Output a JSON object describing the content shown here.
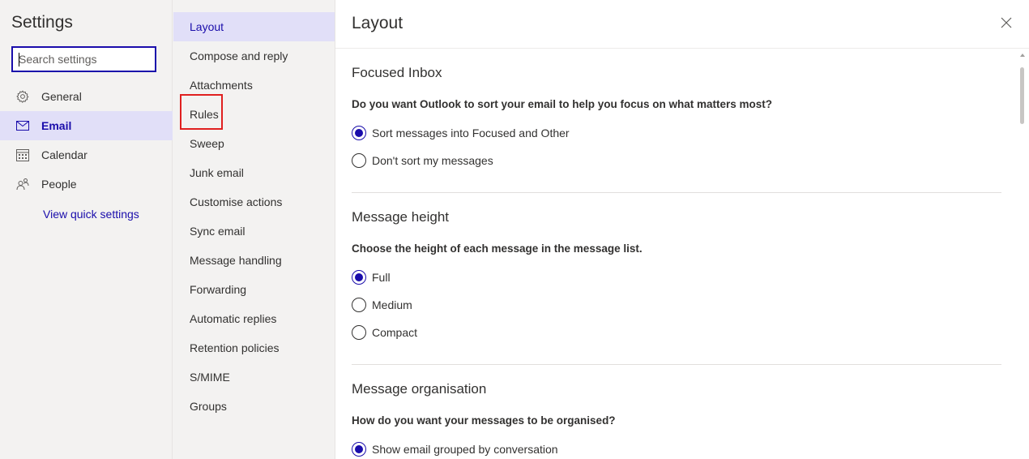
{
  "settings": {
    "title": "Settings",
    "search_placeholder": "Search settings",
    "categories": [
      {
        "label": "General",
        "icon": "gear-icon"
      },
      {
        "label": "Email",
        "icon": "mail-icon",
        "selected": true
      },
      {
        "label": "Calendar",
        "icon": "calendar-icon"
      },
      {
        "label": "People",
        "icon": "people-icon"
      }
    ],
    "quick_settings_link": "View quick settings"
  },
  "email_nav": {
    "items": [
      {
        "label": "Layout",
        "selected": true
      },
      {
        "label": "Compose and reply"
      },
      {
        "label": "Attachments"
      },
      {
        "label": "Rules",
        "highlighted": true
      },
      {
        "label": "Sweep"
      },
      {
        "label": "Junk email"
      },
      {
        "label": "Customise actions"
      },
      {
        "label": "Sync email"
      },
      {
        "label": "Message handling"
      },
      {
        "label": "Forwarding"
      },
      {
        "label": "Automatic replies"
      },
      {
        "label": "Retention policies"
      },
      {
        "label": "S/MIME"
      },
      {
        "label": "Groups"
      }
    ]
  },
  "panel": {
    "title": "Layout",
    "close_icon": "close-icon",
    "sections": [
      {
        "title": "Focused Inbox",
        "question": "Do you want Outlook to sort your email to help you focus on what matters most?",
        "options": [
          {
            "label": "Sort messages into Focused and Other",
            "checked": true
          },
          {
            "label": "Don't sort my messages",
            "checked": false
          }
        ]
      },
      {
        "title": "Message height",
        "question": "Choose the height of each message in the message list.",
        "options": [
          {
            "label": "Full",
            "checked": true
          },
          {
            "label": "Medium",
            "checked": false
          },
          {
            "label": "Compact",
            "checked": false
          }
        ]
      },
      {
        "title": "Message organisation",
        "question": "How do you want your messages to be organised?",
        "options": [
          {
            "label": "Show email grouped by conversation",
            "checked": true
          }
        ]
      }
    ]
  },
  "colors": {
    "accent": "#1a0dab",
    "selected_bg": "#e1dff8",
    "nav_bg": "#f3f2f1",
    "highlight_box": "#e02020"
  }
}
